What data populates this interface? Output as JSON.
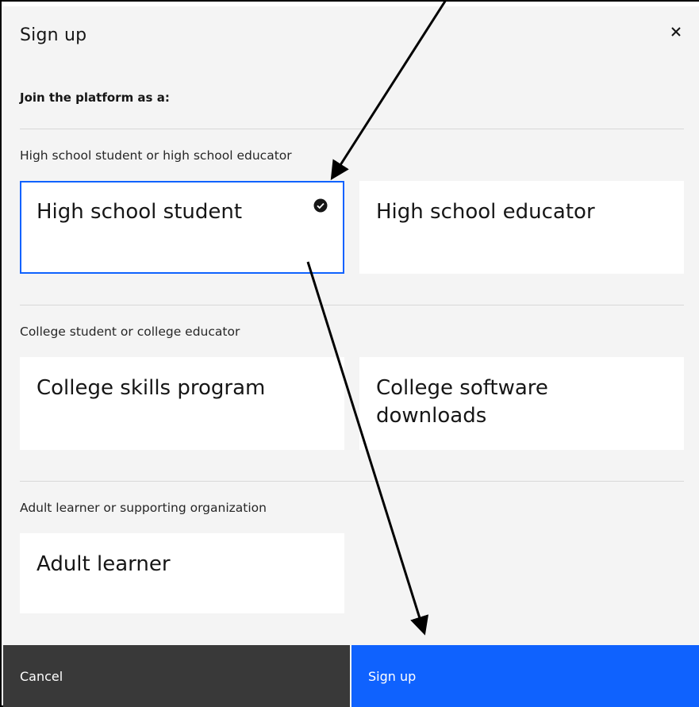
{
  "modal": {
    "title": "Sign up",
    "close_icon": "close-icon",
    "prompt": "Join the platform as a:"
  },
  "sections": [
    {
      "label": "High school student or high school educator",
      "options": [
        {
          "label": "High school student",
          "selected": true
        },
        {
          "label": "High school educator",
          "selected": false
        }
      ]
    },
    {
      "label": "College student or college educator",
      "options": [
        {
          "label": "College skills program",
          "selected": false
        },
        {
          "label": "College software downloads",
          "selected": false
        }
      ]
    },
    {
      "label": "Adult learner or supporting organization",
      "options": [
        {
          "label": "Adult learner",
          "selected": false
        }
      ]
    }
  ],
  "footer": {
    "cancel_label": "Cancel",
    "signup_label": "Sign up"
  },
  "colors": {
    "accent": "#0f62fe",
    "cancel_bg": "#393939",
    "modal_bg": "#f4f4f4",
    "card_bg": "#ffffff"
  },
  "annotations": {
    "arrow_icon": "arrow-icon",
    "check_icon": "checkmark-filled-icon"
  }
}
